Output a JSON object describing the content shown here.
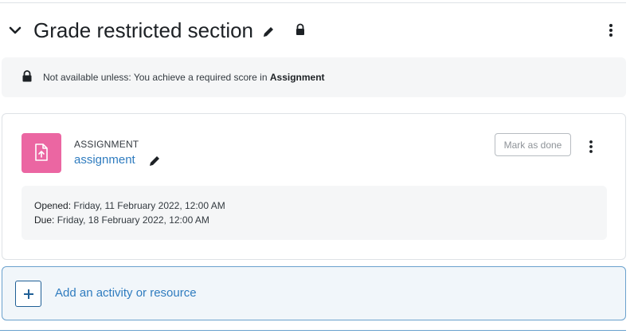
{
  "section": {
    "title": "Grade restricted section",
    "collapse_icon": "chevron-down-icon",
    "edit_icon": "pencil-icon",
    "lock_icon": "lock-icon",
    "menu_icon": "kebab-menu-icon"
  },
  "availability": {
    "prefix": "Not available unless: You achieve a required score in ",
    "target": "Assignment",
    "icon": "lock-icon"
  },
  "activity": {
    "type_label": "ASSIGNMENT",
    "name": "assignment",
    "icon": "assignment-upload-icon",
    "icon_color": "#eb66a2",
    "mark_done_label": "Mark as done",
    "dates": {
      "opened_label": "Opened:",
      "opened_value": " Friday, 11 February 2022, 12:00 AM",
      "due_label": "Due:",
      "due_value": " Friday, 18 February 2022, 12:00 AM"
    }
  },
  "add_activity": {
    "label": "Add an activity or resource",
    "icon": "plus-icon"
  },
  "colors": {
    "link": "#2f7cbf",
    "add_border": "#6aa1cd",
    "panel_bg": "#f5f6f7"
  }
}
